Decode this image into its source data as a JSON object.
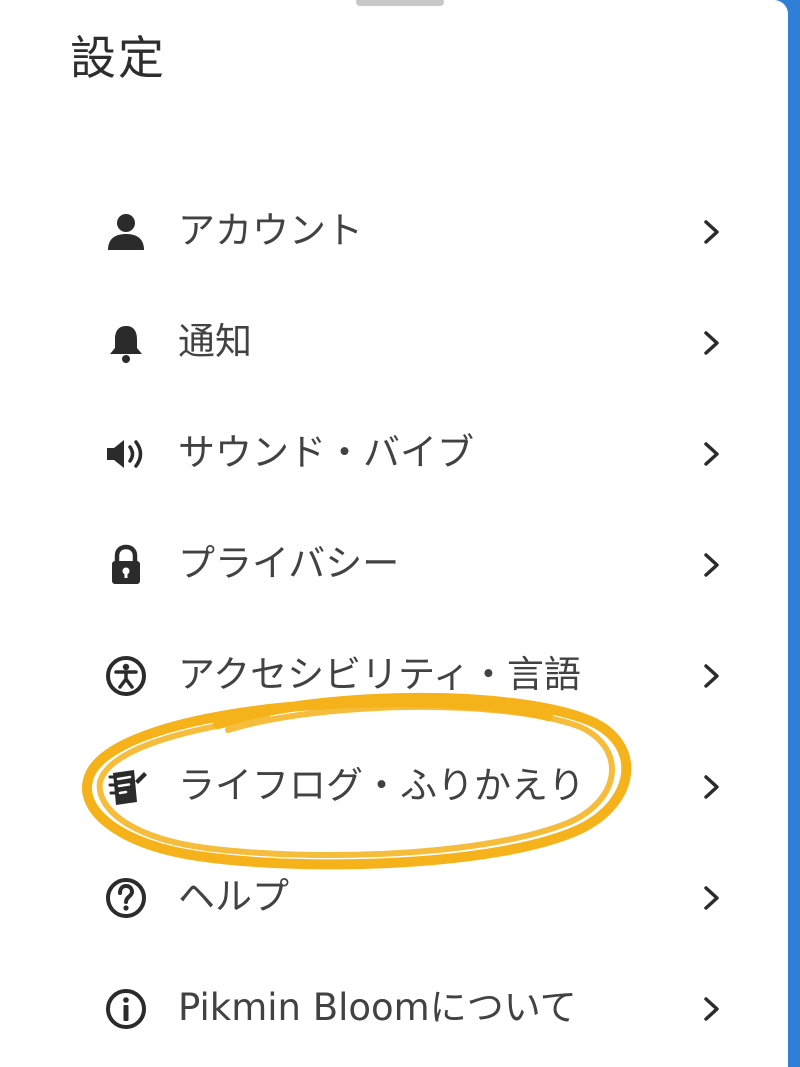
{
  "header": {
    "title": "設定"
  },
  "menu": {
    "items": [
      {
        "label": "アカウント",
        "icon": "person-icon"
      },
      {
        "label": "通知",
        "icon": "bell-icon"
      },
      {
        "label": "サウンド・バイブ",
        "icon": "speaker-icon"
      },
      {
        "label": "プライバシー",
        "icon": "lock-icon"
      },
      {
        "label": "アクセシビリティ・言語",
        "icon": "accessibility-icon"
      },
      {
        "label": "ライフログ・ふりかえり",
        "icon": "lifelog-icon"
      },
      {
        "label": "ヘルプ",
        "icon": "help-icon"
      },
      {
        "label": "Pikmin Bloomについて",
        "icon": "info-icon"
      }
    ]
  },
  "colors": {
    "icon": "#2b2b2b",
    "text": "#424242",
    "highlight_circle": "#f5b21a",
    "background_edge": "#2f7fd6"
  }
}
